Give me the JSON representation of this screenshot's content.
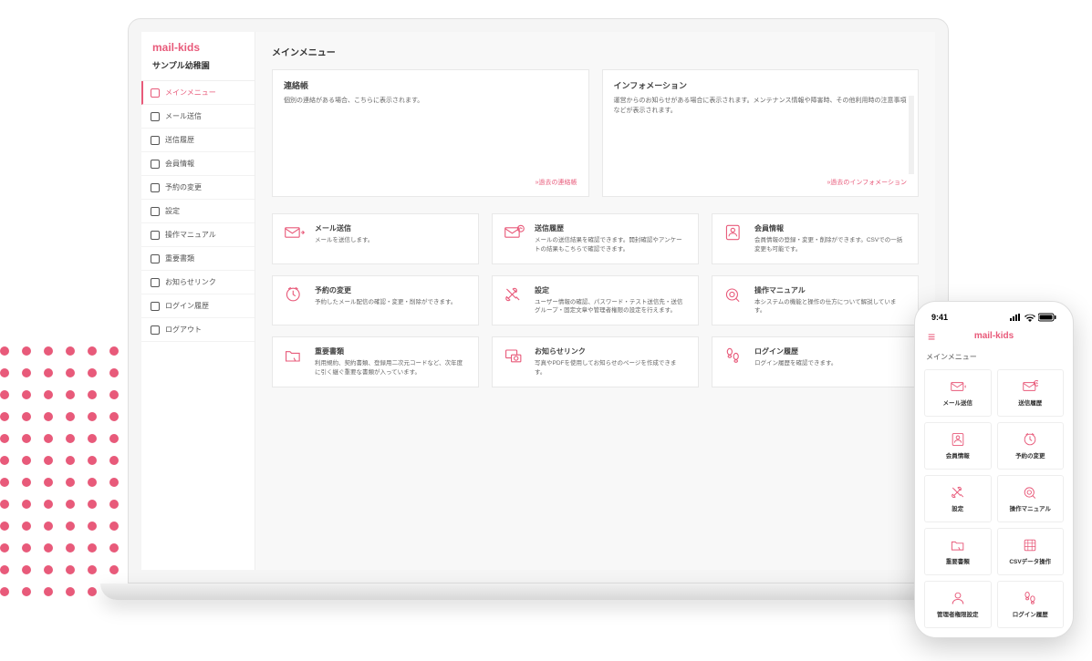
{
  "brand": "mail-kids",
  "org": "サンプル幼稚園",
  "page_title": "メインメニュー",
  "sidebar": {
    "items": [
      {
        "label": "メインメニュー",
        "icon": "home"
      },
      {
        "label": "メール送信",
        "icon": "mail"
      },
      {
        "label": "送信履歴",
        "icon": "history"
      },
      {
        "label": "会員情報",
        "icon": "members"
      },
      {
        "label": "予約の変更",
        "icon": "calendar"
      },
      {
        "label": "設定",
        "icon": "settings"
      },
      {
        "label": "操作マニュアル",
        "icon": "manual"
      },
      {
        "label": "重要書類",
        "icon": "docs"
      },
      {
        "label": "お知らせリンク",
        "icon": "link"
      },
      {
        "label": "ログイン履歴",
        "icon": "login"
      },
      {
        "label": "ログアウト",
        "icon": "logout"
      }
    ]
  },
  "panels": {
    "contacts": {
      "title": "連絡帳",
      "desc": "個別の連絡がある場合、こちらに表示されます。",
      "link": "»過去の連絡帳"
    },
    "info": {
      "title": "インフォメーション",
      "desc": "運営からのお知らせがある場合に表示されます。メンテナンス情報や障害時、その他利用時の注意事項などが表示されます。",
      "link": "»過去のインフォメーション"
    }
  },
  "cards": [
    {
      "icon": "mail-send",
      "title": "メール送信",
      "desc": "メールを送信します。"
    },
    {
      "icon": "mail-history",
      "title": "送信履歴",
      "desc": "メールの送信結果を確認できます。開封確認やアンケートの結果もこちらで確認できます。"
    },
    {
      "icon": "member",
      "title": "会員情報",
      "desc": "会員情報の登録・変更・削除ができます。CSVでの一括変更も可能です。"
    },
    {
      "icon": "clock",
      "title": "予約の変更",
      "desc": "予約したメール配信の確認・変更・削除ができます。"
    },
    {
      "icon": "tools",
      "title": "設定",
      "desc": "ユーザー情報の確認、パスワード・テスト送信先・送信グループ・固定文章や管理者権限の設定を行えます。"
    },
    {
      "icon": "search",
      "title": "操作マニュアル",
      "desc": "本システムの機能と操作の仕方について解説しています。"
    },
    {
      "icon": "folder",
      "title": "重要書類",
      "desc": "利用規約、契約書類、登録用二次元コードなど、次年度に引く継ぐ重要な書類が入っています。"
    },
    {
      "icon": "camera",
      "title": "お知らせリンク",
      "desc": "写真やPDFを使用してお知らせのページを作成できます。"
    },
    {
      "icon": "footsteps",
      "title": "ログイン履歴",
      "desc": "ログイン履歴を確認できます。"
    }
  ],
  "phone": {
    "time": "9:41",
    "page_title": "メインメニュー",
    "cards": [
      {
        "icon": "mail-send",
        "label": "メール送信"
      },
      {
        "icon": "mail-history",
        "label": "送信履歴"
      },
      {
        "icon": "member",
        "label": "会員情報"
      },
      {
        "icon": "clock",
        "label": "予約の変更"
      },
      {
        "icon": "tools",
        "label": "設定"
      },
      {
        "icon": "search",
        "label": "操作マニュアル"
      },
      {
        "icon": "folder",
        "label": "重要書類"
      },
      {
        "icon": "csv",
        "label": "CSVデータ操作"
      },
      {
        "icon": "admin",
        "label": "管理者権限設定"
      },
      {
        "icon": "footsteps",
        "label": "ログイン履歴"
      }
    ]
  }
}
